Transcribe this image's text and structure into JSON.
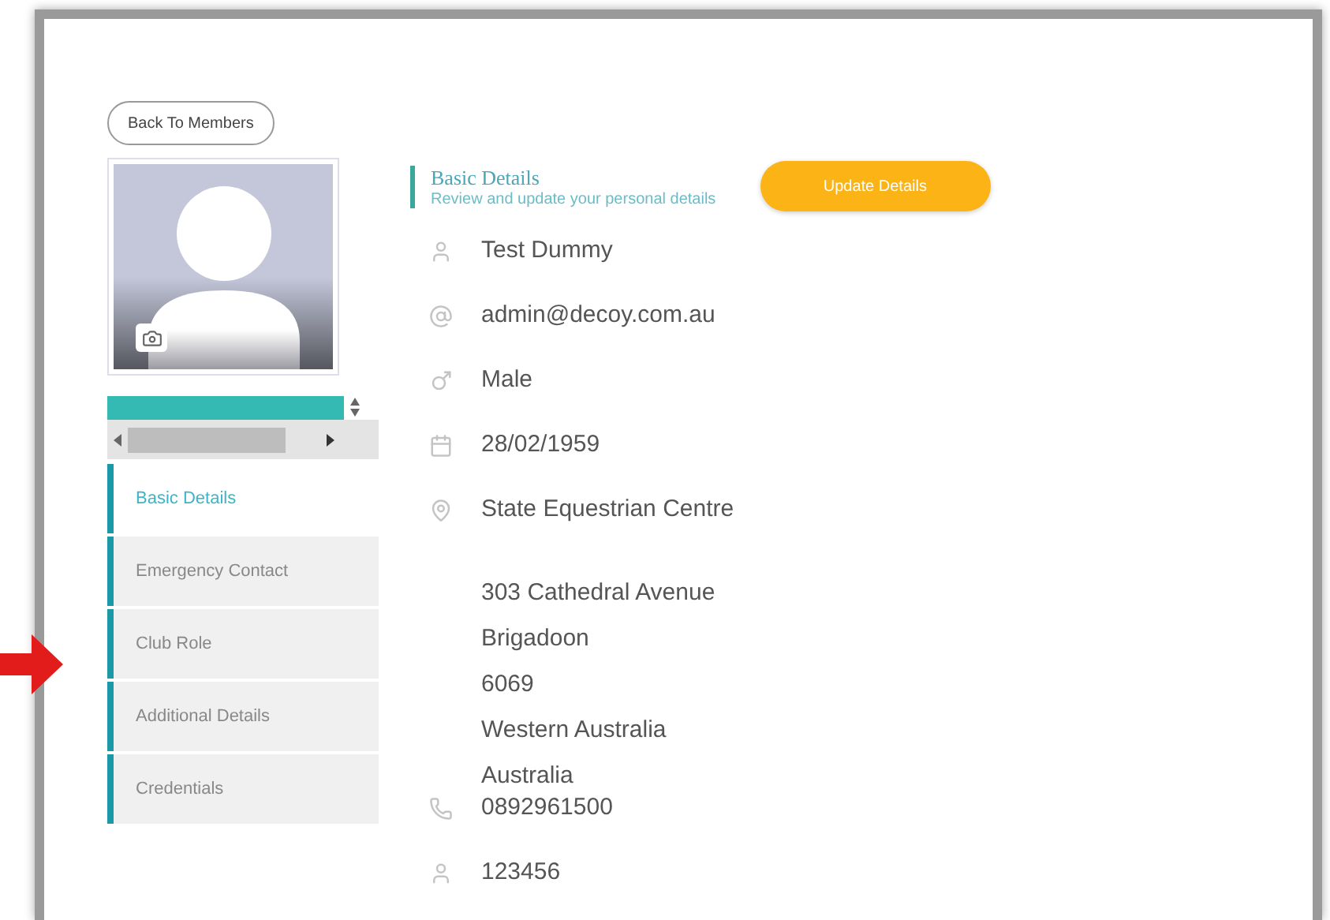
{
  "back_button": "Back To Members",
  "nav": [
    {
      "label": "Basic Details",
      "selected": true
    },
    {
      "label": "Emergency Contact",
      "selected": false
    },
    {
      "label": "Club Role",
      "selected": false
    },
    {
      "label": "Additional Details",
      "selected": false
    },
    {
      "label": "Credentials",
      "selected": false
    }
  ],
  "section": {
    "title": "Basic Details",
    "subtitle": "Review and update your personal details",
    "button": "Update Details"
  },
  "details": [
    {
      "kind": "name",
      "lines": [
        "Test Dummy"
      ]
    },
    {
      "kind": "email",
      "lines": [
        "admin@decoy.com.au"
      ]
    },
    {
      "kind": "gender",
      "lines": [
        "Male"
      ]
    },
    {
      "kind": "birthdate",
      "lines": [
        "28/02/1959"
      ]
    },
    {
      "kind": "location",
      "lines": [
        "State Equestrian Centre"
      ]
    },
    {
      "kind": "address",
      "lines": [
        "303 Cathedral Avenue",
        "Brigadoon",
        "6069",
        "Western Australia",
        "Australia"
      ]
    },
    {
      "kind": "phone",
      "lines": [
        "0892961500"
      ]
    },
    {
      "kind": "member",
      "lines": [
        "123456"
      ]
    }
  ]
}
